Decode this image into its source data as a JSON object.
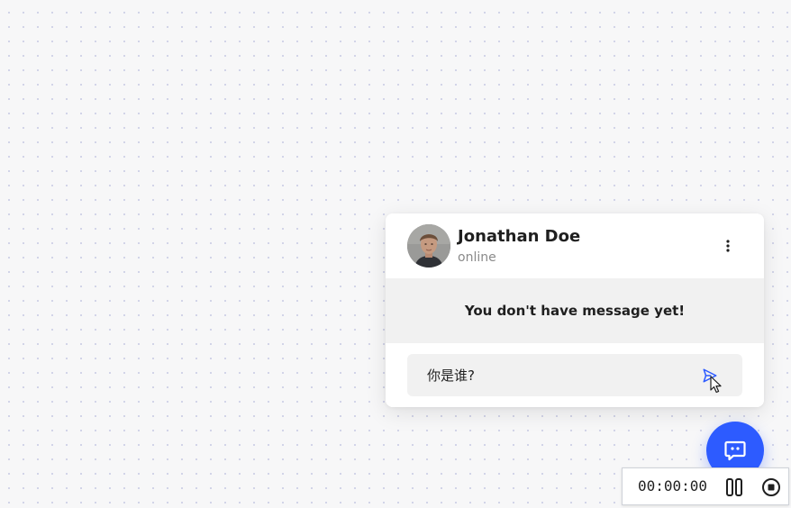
{
  "chat": {
    "contact_name": "Jonathan Doe",
    "status": "online",
    "empty_message": "You don't have message yet!",
    "input_value": "你是谁?",
    "more_icon": "more-vertical-icon",
    "send_icon": "send-icon"
  },
  "fab": {
    "icon": "chat-bubble-icon",
    "color": "#2d5bff"
  },
  "recorder": {
    "time": "00:00:00",
    "pause_icon": "pause-icon",
    "stop_icon": "stop-icon"
  },
  "colors": {
    "accent": "#2d5bff",
    "card_bg": "#ffffff",
    "muted_bg": "#f1f1f1",
    "status_text": "#8a8a8a"
  }
}
